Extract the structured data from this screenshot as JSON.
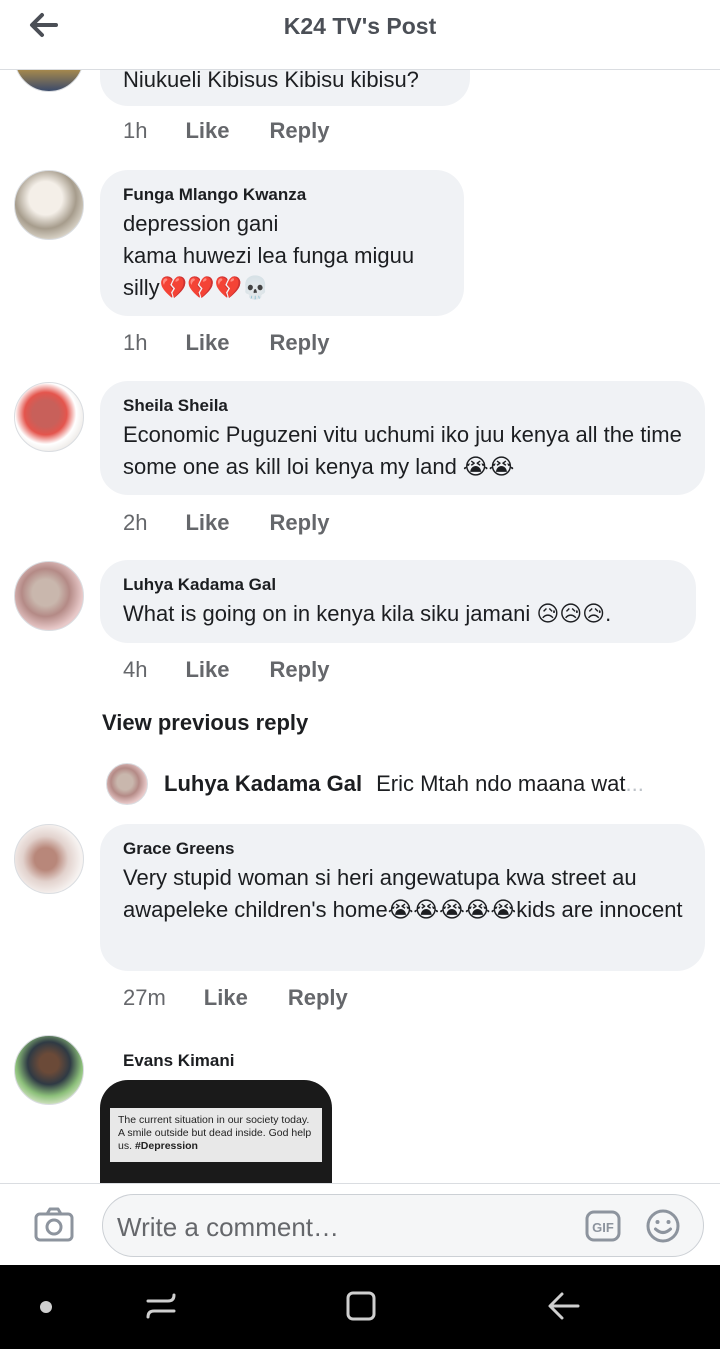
{
  "header": {
    "title": "K24 TV's Post"
  },
  "comments": [
    {
      "author": "",
      "text": "Niukueli Kibisus Kibisu kibisu?",
      "time": "1h"
    },
    {
      "author": "Funga Mlango Kwanza",
      "text": "depression gani\nkama huwezi lea funga miguu\nsilly💔💔💔💀",
      "time": "1h"
    },
    {
      "author": "Sheila Sheila",
      "text": "Economic Puguzeni vitu uchumi iko juu kenya all the time some one as kill loi kenya my land 😭😭",
      "time": "2h"
    },
    {
      "author": "Luhya Kadama Gal",
      "text": "What is going on in kenya kila siku jamani 😥😥😥.",
      "time": "4h"
    },
    {
      "author": "Grace Greens",
      "text": "Very stupid woman si heri angewatupa kwa street au awapeleke children's home😭😭😭😭😭kids are innocent",
      "time": "27m"
    },
    {
      "author": "Evans Kimani",
      "image_caption": "The current situation in our society today. A smile outside but dead inside. God help us.",
      "image_hashtag": "#Depression"
    }
  ],
  "actions": {
    "like": "Like",
    "reply": "Reply"
  },
  "view_previous": "View previous reply",
  "reply_preview": {
    "author": "Luhya Kadama Gal",
    "text": "Eric Mtah  ndo maana wat",
    "ellipsis": "..."
  },
  "composer": {
    "placeholder": "Write a comment…"
  }
}
